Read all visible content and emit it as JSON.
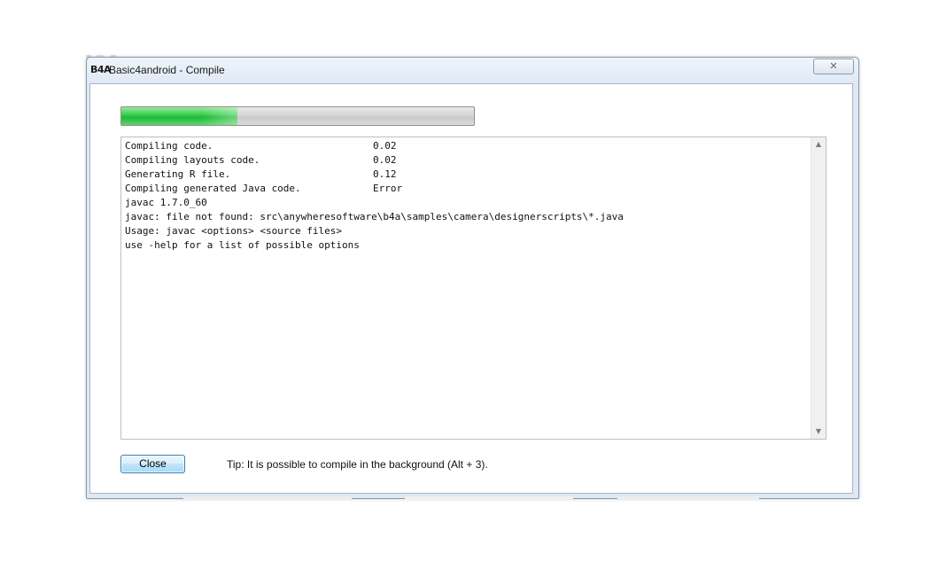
{
  "window": {
    "logo": "B4A",
    "title": "Basic4android - Compile",
    "close_glyph": "✕"
  },
  "progress": {
    "fraction": 0.33,
    "fill_color": "#22c03a"
  },
  "log": {
    "lines": [
      {
        "label": "Compiling code.",
        "value": "0.02"
      },
      {
        "label": "Compiling layouts code.",
        "value": "0.02"
      },
      {
        "label": "Generating R file.",
        "value": "0.12"
      },
      {
        "label": "Compiling generated Java code.",
        "value": "Error"
      },
      {
        "label": "javac 1.7.0_60",
        "value": ""
      },
      {
        "label": "javac: file not found: src\\anywheresoftware\\b4a\\samples\\camera\\designerscripts\\*.java",
        "value": ""
      },
      {
        "label": "Usage: javac <options> <source files>",
        "value": ""
      },
      {
        "label": "use -help for a list of possible options",
        "value": ""
      }
    ]
  },
  "scrollbar": {
    "up_glyph": "▲",
    "down_glyph": "▼"
  },
  "footer": {
    "close_label": "Close",
    "tip": "Tip: It is possible to compile in the background (Alt + 3)."
  }
}
